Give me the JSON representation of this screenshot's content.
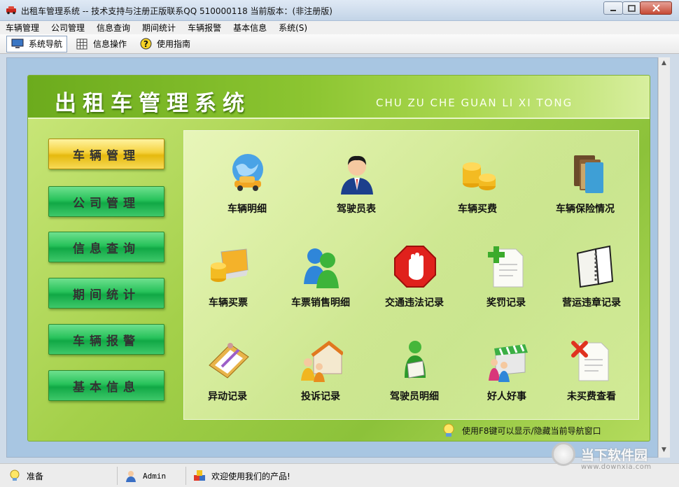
{
  "window": {
    "title": "出租车管理系统 -- 技术支持与注册正版联系QQ 510000118     当前版本：(非注册版)"
  },
  "menu": [
    "车辆管理",
    "公司管理",
    "信息查询",
    "期间统计",
    "车辆报警",
    "基本信息",
    "系统(S)"
  ],
  "toolbar": [
    {
      "label": "系统导航",
      "icon": "monitor-icon",
      "active": true
    },
    {
      "label": "信息操作",
      "icon": "grid-icon",
      "active": false
    },
    {
      "label": "使用指南",
      "icon": "help-icon",
      "active": false
    }
  ],
  "panel": {
    "title": "出租车管理系统",
    "subtitle": "CHU ZU CHE GUAN LI XI TONG"
  },
  "side_nav": [
    {
      "label": "车辆管理",
      "selected": true
    },
    {
      "label": "公司管理",
      "selected": false
    },
    {
      "label": "信息查询",
      "selected": false
    },
    {
      "label": "期间统计",
      "selected": false
    },
    {
      "label": "车辆报警",
      "selected": false
    },
    {
      "label": "基本信息",
      "selected": false
    }
  ],
  "tiles": [
    {
      "label": "车辆明细",
      "icon": "globe-car-icon"
    },
    {
      "label": "驾驶员表",
      "icon": "driver-icon"
    },
    {
      "label": "车辆买费",
      "icon": "coins-icon"
    },
    {
      "label": "车辆保险情况",
      "icon": "binders-icon"
    },
    {
      "label": "车辆买票",
      "icon": "laptop-coins-icon"
    },
    {
      "label": "车票销售明细",
      "icon": "users-icon"
    },
    {
      "label": "交通违法记录",
      "icon": "stop-hand-icon"
    },
    {
      "label": "奖罚记录",
      "icon": "add-document-icon"
    },
    {
      "label": "营运违章记录",
      "icon": "notebook-icon"
    },
    {
      "label": "异动记录",
      "icon": "clipboard-pen-icon"
    },
    {
      "label": "投诉记录",
      "icon": "house-people-icon"
    },
    {
      "label": "驾驶员明细",
      "icon": "person-document-icon"
    },
    {
      "label": "好人好事",
      "icon": "shop-people-icon"
    },
    {
      "label": "未买费查看",
      "icon": "delete-document-icon"
    }
  ],
  "hint": "使用F8键可以显示/隐藏当前导航窗口",
  "status": {
    "ready": "准备",
    "user": "Admin",
    "message": "欢迎使用我们的产品!"
  },
  "watermark": {
    "brand": "当下软件园",
    "url": "www.downxia.com"
  }
}
